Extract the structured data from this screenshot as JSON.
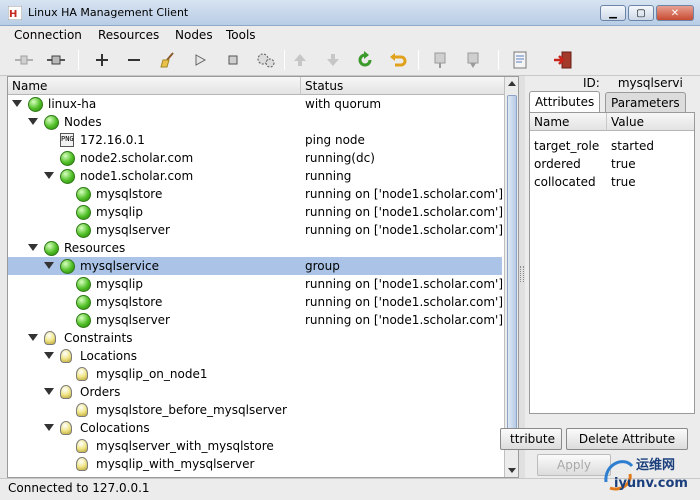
{
  "window": {
    "title": "Linux HA Management Client",
    "minimize_icon": "minimize-icon",
    "maximize_icon": "maximize-icon",
    "close_icon": "close-icon"
  },
  "menu": [
    "Connection",
    "Resources",
    "Nodes",
    "Tools"
  ],
  "toolbar": {
    "icons": [
      "disconnect-icon",
      "connect-icon",
      "add-icon",
      "remove-icon",
      "cleanup-broom-icon",
      "start-icon",
      "stop-icon",
      "migrate-gears-icon",
      "move-up-icon",
      "move-down-icon",
      "refresh-icon",
      "undo-icon",
      "standby-icon",
      "active-icon",
      "view-log-icon",
      "exit-icon"
    ]
  },
  "tree": {
    "columns": {
      "name": "Name",
      "status": "Status"
    },
    "rows": [
      {
        "label": "linux-ha",
        "status": "with quorum",
        "icon": "green-status-icon",
        "expanded": true
      },
      {
        "label": "Nodes",
        "status": "",
        "icon": "green-status-icon",
        "expanded": true
      },
      {
        "label": "172.16.0.1",
        "status": "ping node",
        "icon": "ping-node-icon"
      },
      {
        "label": "node2.scholar.com",
        "status": "running(dc)",
        "icon": "green-status-icon"
      },
      {
        "label": "node1.scholar.com",
        "status": "running",
        "icon": "green-status-icon",
        "expanded": true
      },
      {
        "label": "mysqlstore",
        "status": "running on ['node1.scholar.com']",
        "icon": "green-status-icon"
      },
      {
        "label": "mysqlip",
        "status": "running on ['node1.scholar.com']",
        "icon": "green-status-icon"
      },
      {
        "label": "mysqlserver",
        "status": "running on ['node1.scholar.com']",
        "icon": "green-status-icon"
      },
      {
        "label": "Resources",
        "status": "",
        "icon": "green-status-icon",
        "expanded": true
      },
      {
        "label": "mysqlservice",
        "status": "group",
        "icon": "green-status-icon",
        "expanded": true,
        "selected": true
      },
      {
        "label": "mysqlip",
        "status": "running on ['node1.scholar.com']",
        "icon": "green-status-icon"
      },
      {
        "label": "mysqlstore",
        "status": "running on ['node1.scholar.com']",
        "icon": "green-status-icon"
      },
      {
        "label": "mysqlserver",
        "status": "running on ['node1.scholar.com']",
        "icon": "green-status-icon"
      },
      {
        "label": "Constraints",
        "status": "",
        "icon": "constraint-icon",
        "expanded": true
      },
      {
        "label": "Locations",
        "status": "",
        "icon": "constraint-icon",
        "expanded": true
      },
      {
        "label": "mysqlip_on_node1",
        "status": "",
        "icon": "constraint-icon"
      },
      {
        "label": "Orders",
        "status": "",
        "icon": "constraint-icon",
        "expanded": true
      },
      {
        "label": "mysqlstore_before_mysqlserver",
        "status": "",
        "icon": "constraint-icon"
      },
      {
        "label": "Colocations",
        "status": "",
        "icon": "constraint-icon",
        "expanded": true
      },
      {
        "label": "mysqlserver_with_mysqlstore",
        "status": "",
        "icon": "constraint-icon"
      },
      {
        "label": "mysqlip_with_mysqlserver",
        "status": "",
        "icon": "constraint-icon"
      }
    ]
  },
  "details": {
    "id_label": "ID:",
    "id_value": "mysqlservi",
    "tabs": [
      "Attributes",
      "Parameters"
    ],
    "columns": {
      "name": "Name",
      "value": "Value"
    },
    "attributes": [
      {
        "name": "target_role",
        "value": "started"
      },
      {
        "name": "ordered",
        "value": "true"
      },
      {
        "name": "collocated",
        "value": "true"
      }
    ],
    "add_button": "ttribute",
    "delete_button": "Delete Attribute",
    "apply_button": "Apply"
  },
  "statusbar": {
    "text": "Connected to 127.0.0.1"
  },
  "watermark": {
    "cn": "运维网",
    "url": "iyunv.com"
  }
}
